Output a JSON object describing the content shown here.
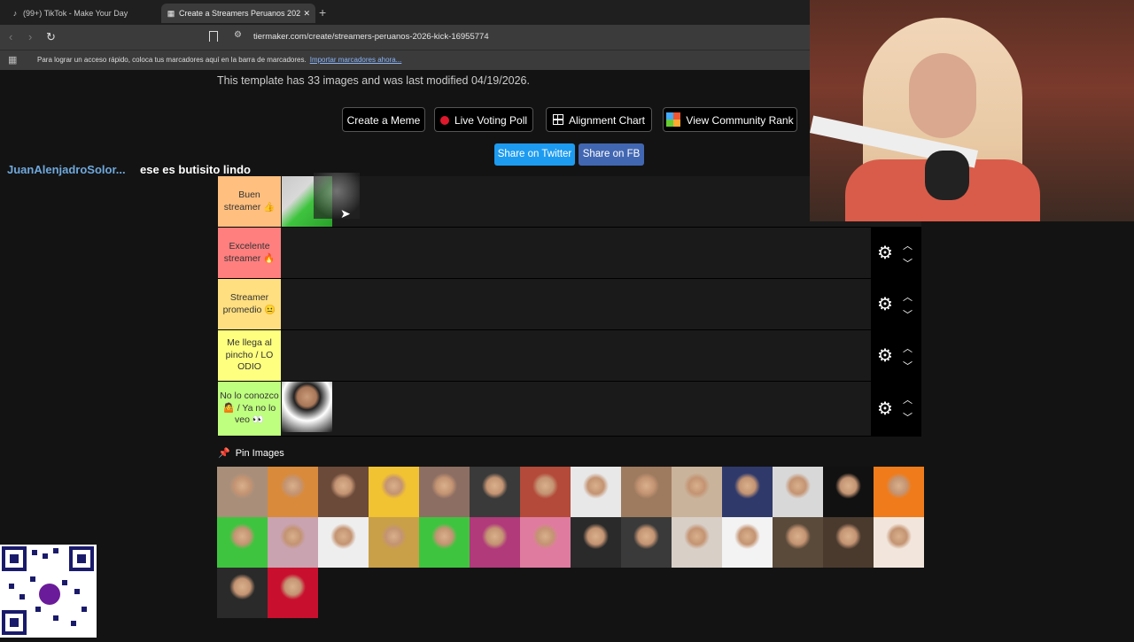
{
  "browser": {
    "tabs": [
      {
        "label": "(99+) TikTok - Make Your Day",
        "icon": "tiktok-icon"
      },
      {
        "label": "Create a Streamers Peruanos 202",
        "icon": "tiermaker-icon"
      }
    ],
    "url": "tiermaker.com/create/streamers-peruanos-2026-kick-16955774",
    "bookmarks_text": "Para lograr un acceso rápido, coloca tus marcadores aquí en la barra de marcadores.",
    "bookmarks_link": "Importar marcadores ahora..."
  },
  "page": {
    "info": "This template has 33 images and was last modified 04/19/2026.",
    "buttons": {
      "meme": "Create a Meme",
      "poll": "Live Voting Poll",
      "alignment": "Alignment Chart",
      "rank": "View Community Rank",
      "twitter": "Share on Twitter",
      "fb": "Share on FB"
    },
    "pin_label": "Pin Images"
  },
  "chat": {
    "name": "JuanAlenjadroSolor...",
    "message": "ese es butisito lindo"
  },
  "tiers": [
    {
      "label": "Buen streamer 👍",
      "color": "#ffbf7f"
    },
    {
      "label": "Excelente streamer 🔥",
      "color": "#ff7f7f"
    },
    {
      "label": "Streamer promedio 😐",
      "color": "#ffdf7f"
    },
    {
      "label": "Me llega al pincho / LO ODIO",
      "color": "#ffff7f"
    },
    {
      "label": "No lo conozco 🤷 / Ya no lo veo 👀",
      "color": "#bfff7f"
    }
  ],
  "image_counts": {
    "pool": 30
  }
}
